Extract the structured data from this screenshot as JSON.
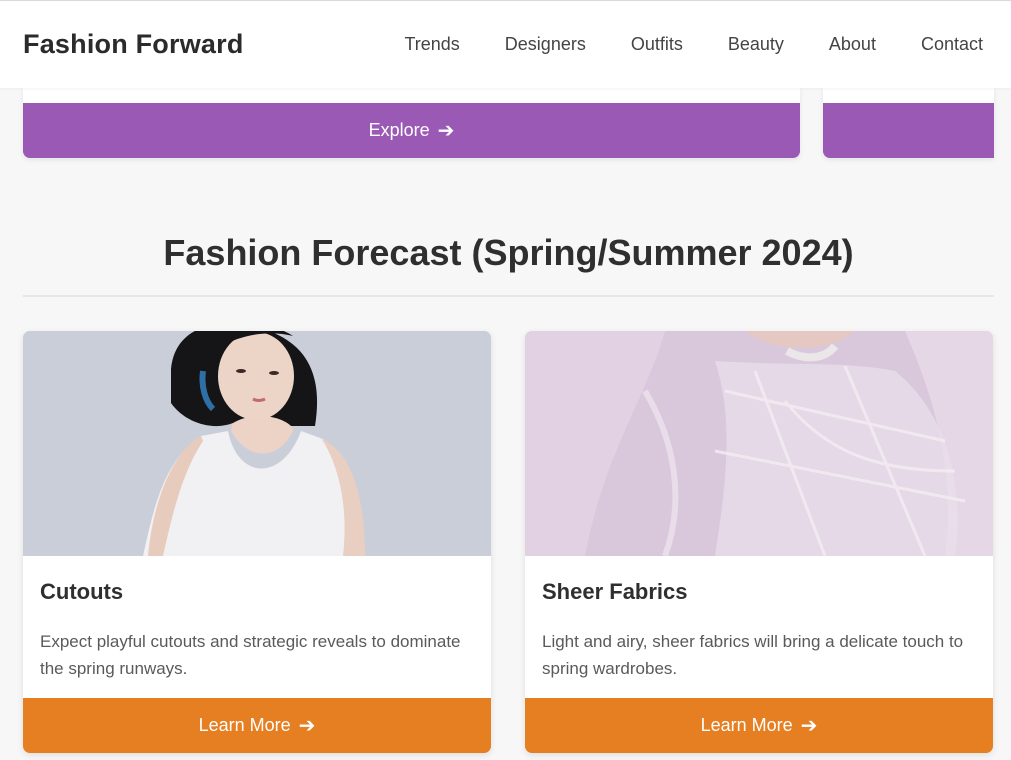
{
  "header": {
    "brand": "Fashion Forward",
    "nav": [
      "Trends",
      "Designers",
      "Outfits",
      "Beauty",
      "About",
      "Contact"
    ]
  },
  "explore": {
    "label": "Explore",
    "color": "#9b59b6"
  },
  "section": {
    "title": "Fashion Forecast (Spring/Summer 2024)"
  },
  "cards": [
    {
      "title": "Cutouts",
      "text": "Expect playful cutouts and strategic reveals to dominate the spring runways.",
      "button": "Learn More"
    },
    {
      "title": "Sheer Fabrics",
      "text": "Light and airy, sheer fabrics will bring a delicate touch to spring wardrobes.",
      "button": "Learn More"
    }
  ],
  "colors": {
    "accent": "#e67e22",
    "purple": "#9b59b6",
    "background": "#f7f7f7"
  },
  "icons": {
    "button_arrow": "arrow-right-icon"
  }
}
